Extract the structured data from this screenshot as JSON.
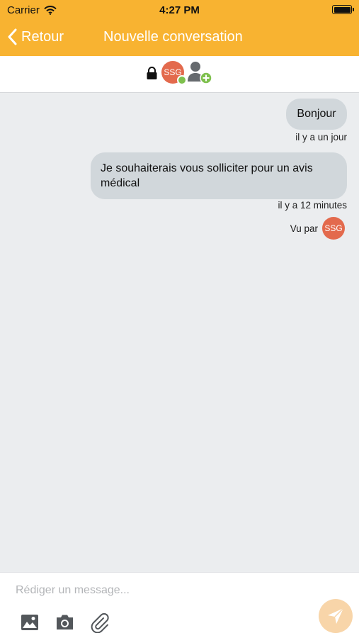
{
  "status_bar": {
    "carrier": "Carrier",
    "time": "4:27 PM"
  },
  "nav": {
    "back_label": "Retour",
    "title": "Nouvelle conversation"
  },
  "participants": {
    "initials": "SSG"
  },
  "messages": [
    {
      "text": "Bonjour",
      "time": "il y a un jour"
    },
    {
      "text": "Je souhaiterais vous solliciter pour un avis médical",
      "time": "il y a 12 minutes"
    }
  ],
  "seen": {
    "label": "Vu par",
    "initials": "SSG"
  },
  "composer": {
    "placeholder": "Rédiger un message..."
  },
  "colors": {
    "header": "#f8b331",
    "avatar": "#e36a4d",
    "bubble": "#d1d7db",
    "online": "#7ec04d",
    "send_button": "#f8d5a9"
  }
}
